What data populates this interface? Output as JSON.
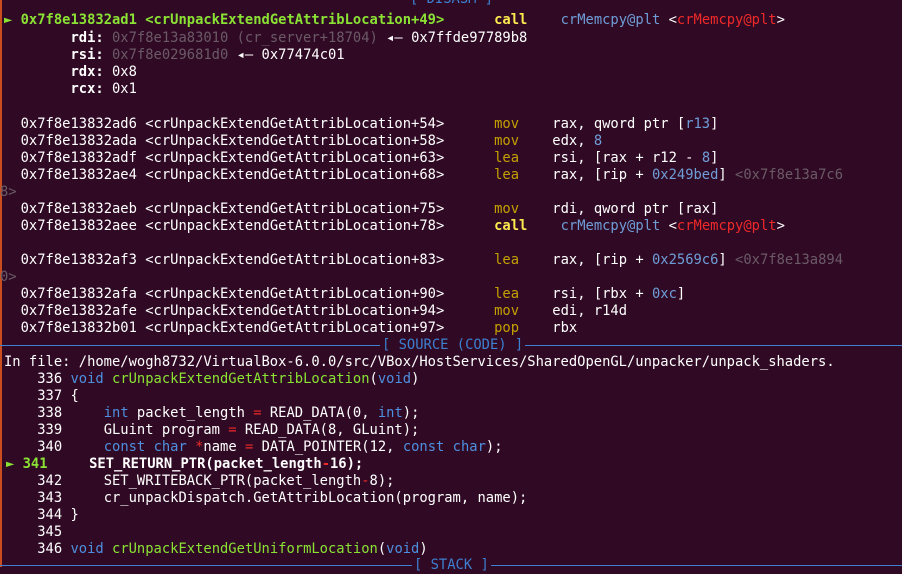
{
  "sections": {
    "disasm": "[ DISASM ]",
    "source": "[ SOURCE (CODE) ]",
    "stack": "[ STACK ]"
  },
  "current": {
    "marker": "►",
    "addr": "0x7f8e13832ad1",
    "sym": "<crUnpackExtendGetAttribLocation+49>",
    "mnemonic": "call",
    "target": "crMemcpy@plt",
    "target_sym": "crMemcpy@plt"
  },
  "args": [
    {
      "reg": "rdi:",
      "value": "0x7f8e13a83010 (cr_server+18704)",
      "arrow": "◂—",
      "deref": "0x7ffde97789b8"
    },
    {
      "reg": "rsi:",
      "value": "0x7f8e029681d0",
      "arrow": "◂—",
      "deref": "0x77474c01"
    },
    {
      "reg": "rdx:",
      "value": "0x8",
      "arrow": "",
      "deref": ""
    },
    {
      "reg": "rcx:",
      "value": "0x1",
      "arrow": "",
      "deref": ""
    }
  ],
  "instructions": [
    {
      "addr": "0x7f8e13832ad6",
      "sym": "<crUnpackExtendGetAttribLocation+54>",
      "mn": "mov",
      "op1": "rax, qword ptr [",
      "op2": "r13",
      "op3": "]",
      "hex": "",
      "tail": ""
    },
    {
      "addr": "0x7f8e13832ada",
      "sym": "<crUnpackExtendGetAttribLocation+58>",
      "mn": "mov",
      "op1": "edx, ",
      "op2": "8",
      "op3": "",
      "hex": "",
      "tail": ""
    },
    {
      "addr": "0x7f8e13832adf",
      "sym": "<crUnpackExtendGetAttribLocation+63>",
      "mn": "lea",
      "op1": "rsi, [rax + r12 - ",
      "op2": "8",
      "op3": "]",
      "hex": "",
      "tail": ""
    },
    {
      "addr": "0x7f8e13832ae4",
      "sym": "<crUnpackExtendGetAttribLocation+68>",
      "mn": "lea",
      "op1": "rax, [rip + ",
      "op2": "0x249bed",
      "op3": "]",
      "hex": "<0x7f8e13a7c6",
      "tail": "8>"
    },
    {
      "addr": "0x7f8e13832aeb",
      "sym": "<crUnpackExtendGetAttribLocation+75>",
      "mn": "mov",
      "op1": "rdi, qword ptr [rax]",
      "op2": "",
      "op3": "",
      "hex": "",
      "tail": ""
    },
    {
      "addr": "0x7f8e13832aee",
      "sym": "<crUnpackExtendGetAttribLocation+78>",
      "mn": "call",
      "op1": "crMemcpy@plt",
      "op2": "<crMemcpy@plt>",
      "op3": "",
      "hex": "",
      "tail": ""
    },
    {
      "addr": "0x7f8e13832af3",
      "sym": "<crUnpackExtendGetAttribLocation+83>",
      "mn": "lea",
      "op1": "rax, [rip + ",
      "op2": "0x2569c6",
      "op3": "]",
      "hex": "<0x7f8e13a894",
      "tail": "0>"
    },
    {
      "addr": "0x7f8e13832afa",
      "sym": "<crUnpackExtendGetAttribLocation+90>",
      "mn": "lea",
      "op1": "rsi, [rbx + ",
      "op2": "0xc",
      "op3": "]",
      "hex": "",
      "tail": ""
    },
    {
      "addr": "0x7f8e13832afe",
      "sym": "<crUnpackExtendGetAttribLocation+94>",
      "mn": "mov",
      "op1": "edi, r14d",
      "op2": "",
      "op3": "",
      "hex": "",
      "tail": ""
    },
    {
      "addr": "0x7f8e13832b01",
      "sym": "<crUnpackExtendGetAttribLocation+97>",
      "mn": "pop",
      "op1": "rbx",
      "op2": "",
      "op3": "",
      "hex": "",
      "tail": ""
    }
  ],
  "source": {
    "file_line": "In file: /home/wogh8732/VirtualBox-6.0.0/src/VBox/HostServices/SharedOpenGL/unpacker/unpack_shaders.",
    "lines": [
      {
        "no": "336",
        "text": "void crUnpackExtendGetAttribLocation(void)"
      },
      {
        "no": "337",
        "text": "{"
      },
      {
        "no": "338",
        "text": "    int packet_length = READ_DATA(0, int);"
      },
      {
        "no": "339",
        "text": "    GLuint program = READ_DATA(8, GLuint);"
      },
      {
        "no": "340",
        "text": "    const char *name = DATA_POINTER(12, const char);"
      },
      {
        "no": "341",
        "text": "    SET_RETURN_PTR(packet_length-16);"
      },
      {
        "no": "342",
        "text": "    SET_WRITEBACK_PTR(packet_length-8);"
      },
      {
        "no": "343",
        "text": "    cr_unpackDispatch.GetAttribLocation(program, name);"
      },
      {
        "no": "344",
        "text": "}"
      },
      {
        "no": "345",
        "text": ""
      },
      {
        "no": "346",
        "text": "void crUnpackExtendGetUniformLocation(void)"
      }
    ],
    "current_marker": "►"
  },
  "colors": {
    "background": "#300a24",
    "separator": "#3d7fd0",
    "current_line": "#8ae234",
    "mnemonic": "#c4a000",
    "symbol_target": "#ef2929"
  }
}
